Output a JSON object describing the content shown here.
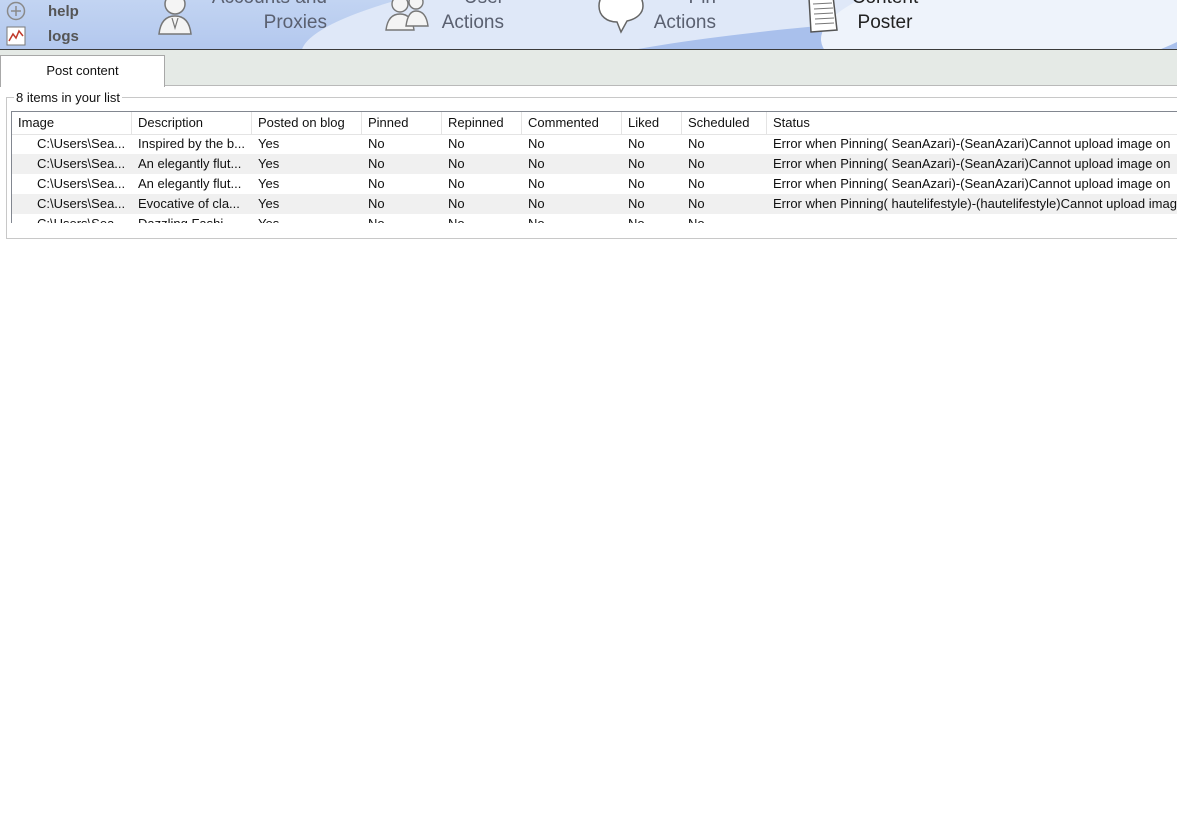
{
  "toolbar": {
    "side_links": [
      {
        "label": "help",
        "icon": "plus-icon"
      },
      {
        "label": "logs",
        "icon": "chart-icon"
      }
    ],
    "nav": [
      {
        "label": "Accounts and\nProxies",
        "icon": "user-icon"
      },
      {
        "label": "User\nActions",
        "icon": "users-icon"
      },
      {
        "label": "Pin\nActions",
        "icon": "speech-bubble-icon"
      },
      {
        "label": "Content\nPoster",
        "icon": "document-icon",
        "active": true
      }
    ]
  },
  "tabs": [
    {
      "label": "Post content",
      "active": true
    }
  ],
  "list": {
    "caption": "8 items in your list",
    "columns": [
      "Image",
      "Description",
      "Posted on blog",
      "Pinned",
      "Repinned",
      "Commented",
      "Liked",
      "Scheduled",
      "Status"
    ],
    "rows": [
      [
        "C:\\Users\\Sea...",
        "Inspired by the b...",
        "Yes",
        "No",
        "No",
        "No",
        "No",
        "No",
        "Error when Pinning( SeanAzari)-(SeanAzari)Cannot upload image on"
      ],
      [
        "C:\\Users\\Sea...",
        "An elegantly flut...",
        "Yes",
        "No",
        "No",
        "No",
        "No",
        "No",
        "Error when Pinning( SeanAzari)-(SeanAzari)Cannot upload image on"
      ],
      [
        "C:\\Users\\Sea...",
        "An elegantly flut...",
        "Yes",
        "No",
        "No",
        "No",
        "No",
        "No",
        "Error when Pinning( SeanAzari)-(SeanAzari)Cannot upload image on"
      ],
      [
        "C:\\Users\\Sea...",
        "Evocative of cla...",
        "Yes",
        "No",
        "No",
        "No",
        "No",
        "No",
        "Error when Pinning( hautelifestyle)-(hautelifestyle)Cannot upload imag"
      ],
      [
        "C:\\Users\\Sea...",
        "Dazzling Fashi...",
        "Yes",
        "No",
        "No",
        "No",
        "No",
        "No",
        ""
      ]
    ]
  },
  "colors": {
    "ribbon": "#b3c8ee",
    "ribbon_highlight": "#dfe8f8",
    "tabstrip": "#e5eae6",
    "alt_row": "#f0f0f0"
  }
}
